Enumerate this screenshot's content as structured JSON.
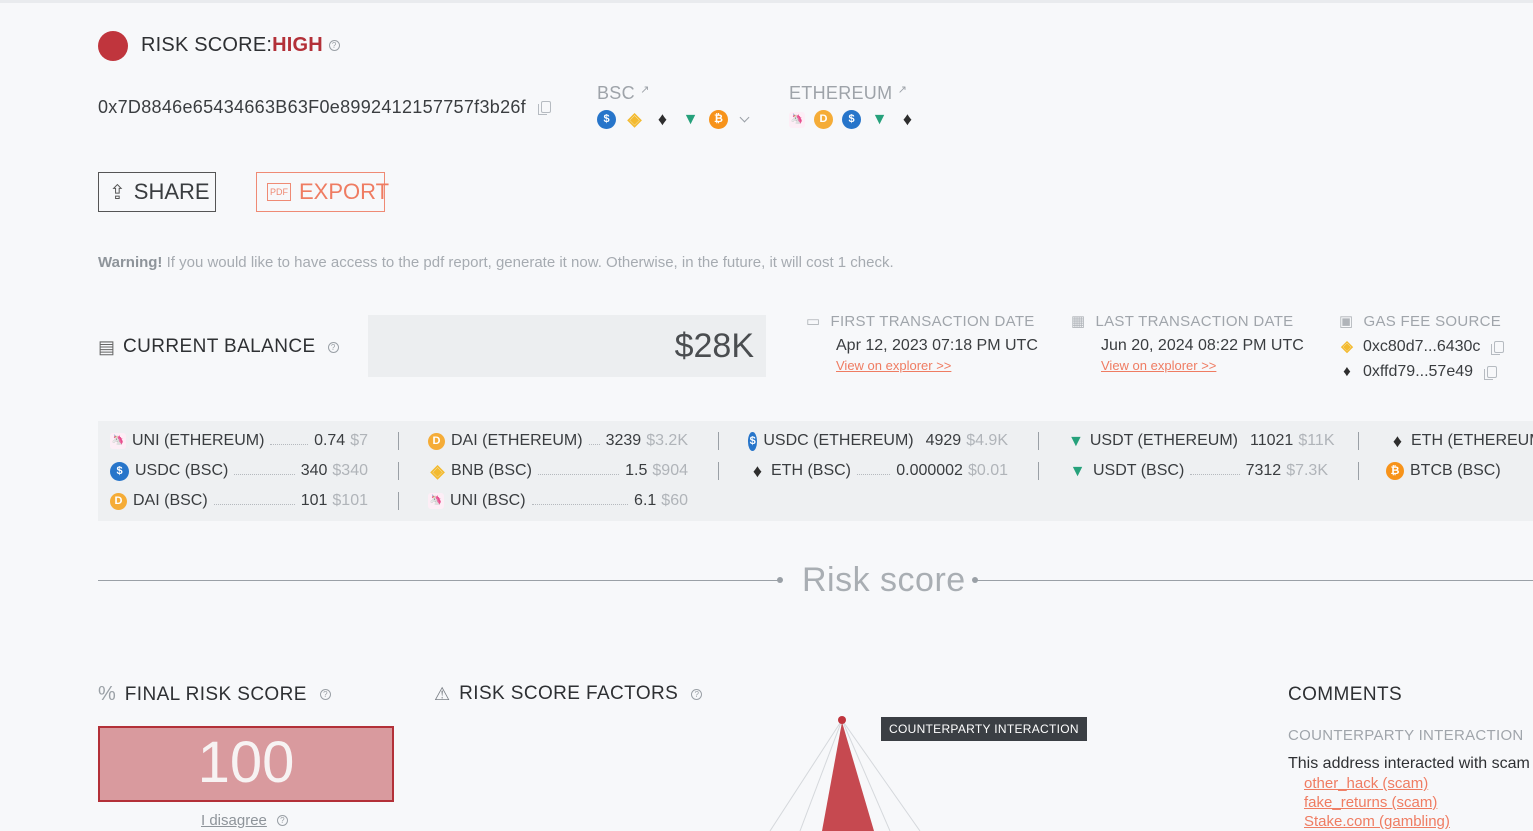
{
  "header": {
    "risk_label": "RISK SCORE:",
    "risk_level": "HIGH",
    "risk_color": "#c0353d"
  },
  "address": "0x7D8846e65434663B63F0e8992412157757f3b26f",
  "networks": [
    {
      "name": "BSC",
      "tokens": [
        "usdc-icon",
        "bnb-icon",
        "eth-icon",
        "usdt-icon",
        "btc-icon"
      ]
    },
    {
      "name": "ETHEREUM",
      "tokens": [
        "uni-icon",
        "dai-icon",
        "usdc-icon",
        "usdt-icon",
        "eth-icon"
      ]
    }
  ],
  "buttons": {
    "share": "SHARE",
    "export": "EXPORT"
  },
  "warning": {
    "bold": "Warning!",
    "text": " If you would like to have access to the pdf report, generate it now. Otherwise, in the future, it will cost 1 check."
  },
  "balance": {
    "label": "CURRENT BALANCE",
    "value": "$28K"
  },
  "first_tx": {
    "label": "FIRST TRANSACTION DATE",
    "date": "Apr 12, 2023 07:18 PM UTC",
    "link": "View on explorer >>"
  },
  "last_tx": {
    "label": "LAST TRANSACTION DATE",
    "date": "Jun 20, 2024 08:22 PM UTC",
    "link": "View on explorer >>"
  },
  "gas": {
    "label": "GAS FEE SOURCE",
    "items": [
      "0xc80d7...6430c",
      "0xffd79...57e49"
    ]
  },
  "holdings": [
    [
      {
        "name": "UNI (ETHEREUM)",
        "amount": "0.74",
        "usd": "$7"
      },
      {
        "name": "DAI (ETHEREUM)",
        "amount": "3239",
        "usd": "$3.2K"
      },
      {
        "name": "USDC (ETHEREUM)",
        "amount": "4929",
        "usd": "$4.9K"
      },
      {
        "name": "USDT (ETHEREUM)",
        "amount": "11021",
        "usd": "$11K"
      },
      {
        "name": "ETH (ETHEREUM)",
        "amount": "",
        "usd": ""
      }
    ],
    [
      {
        "name": "USDC (BSC)",
        "amount": "340",
        "usd": "$340"
      },
      {
        "name": "BNB (BSC)",
        "amount": "1.5",
        "usd": "$904"
      },
      {
        "name": "ETH (BSC)",
        "amount": "0.000002",
        "usd": "$0.01"
      },
      {
        "name": "USDT (BSC)",
        "amount": "7312",
        "usd": "$7.3K"
      },
      {
        "name": "BTCB (BSC)",
        "amount": "",
        "usd": ""
      }
    ],
    [
      {
        "name": "DAI (BSC)",
        "amount": "101",
        "usd": "$101"
      },
      {
        "name": "UNI (BSC)",
        "amount": "6.1",
        "usd": "$60"
      }
    ]
  ],
  "section_title": "Risk score",
  "final": {
    "label": "FINAL RISK SCORE",
    "score": "100",
    "disagree": "I disagree"
  },
  "factors": {
    "label": "RISK SCORE FACTORS",
    "tooltip": "COUNTERPARTY INTERACTION"
  },
  "comments": {
    "label": "COMMENTS",
    "heading": "COUNTERPARTY INTERACTION",
    "text": "This address interacted with scam",
    "links": [
      "other_hack (scam)",
      "fake_returns (scam)",
      "Stake.com (gambling)"
    ]
  }
}
